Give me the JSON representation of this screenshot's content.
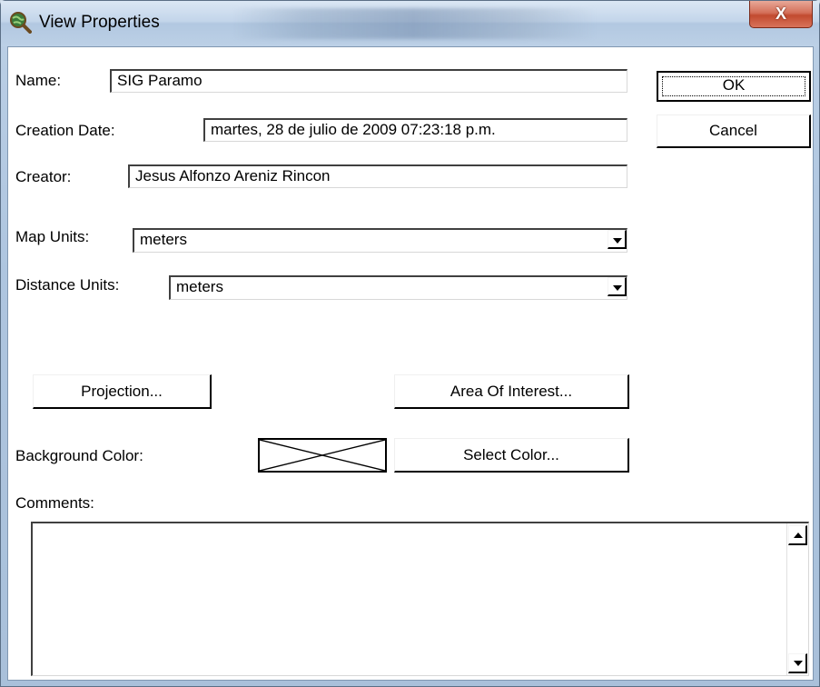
{
  "window": {
    "title": "View Properties",
    "close_label": "X"
  },
  "form": {
    "name_label": "Name:",
    "name_value": "SIG Paramo",
    "creation_date_label": "Creation Date:",
    "creation_date_value": "martes, 28 de julio de 2009 07:23:18 p.m.",
    "creator_label": "Creator:",
    "creator_value": "Jesus Alfonzo Areniz Rincon",
    "map_units_label": "Map Units:",
    "map_units_value": "meters",
    "distance_units_label": "Distance Units:",
    "distance_units_value": "meters",
    "background_color_label": "Background Color:",
    "comments_label": "Comments:",
    "comments_value": ""
  },
  "buttons": {
    "ok": "OK",
    "cancel": "Cancel",
    "projection": "Projection...",
    "area_of_interest": "Area Of Interest...",
    "select_color": "Select Color..."
  },
  "icons": {
    "app": "globe-magnifier-icon",
    "dropdown": "chevron-down-icon",
    "scroll_up": "scroll-up-arrow-icon",
    "scroll_down": "scroll-down-arrow-icon"
  },
  "colors": {
    "accent_close": "#c24a2f",
    "title_bg": "#bcd0e6",
    "client_bg": "#ffffff"
  }
}
